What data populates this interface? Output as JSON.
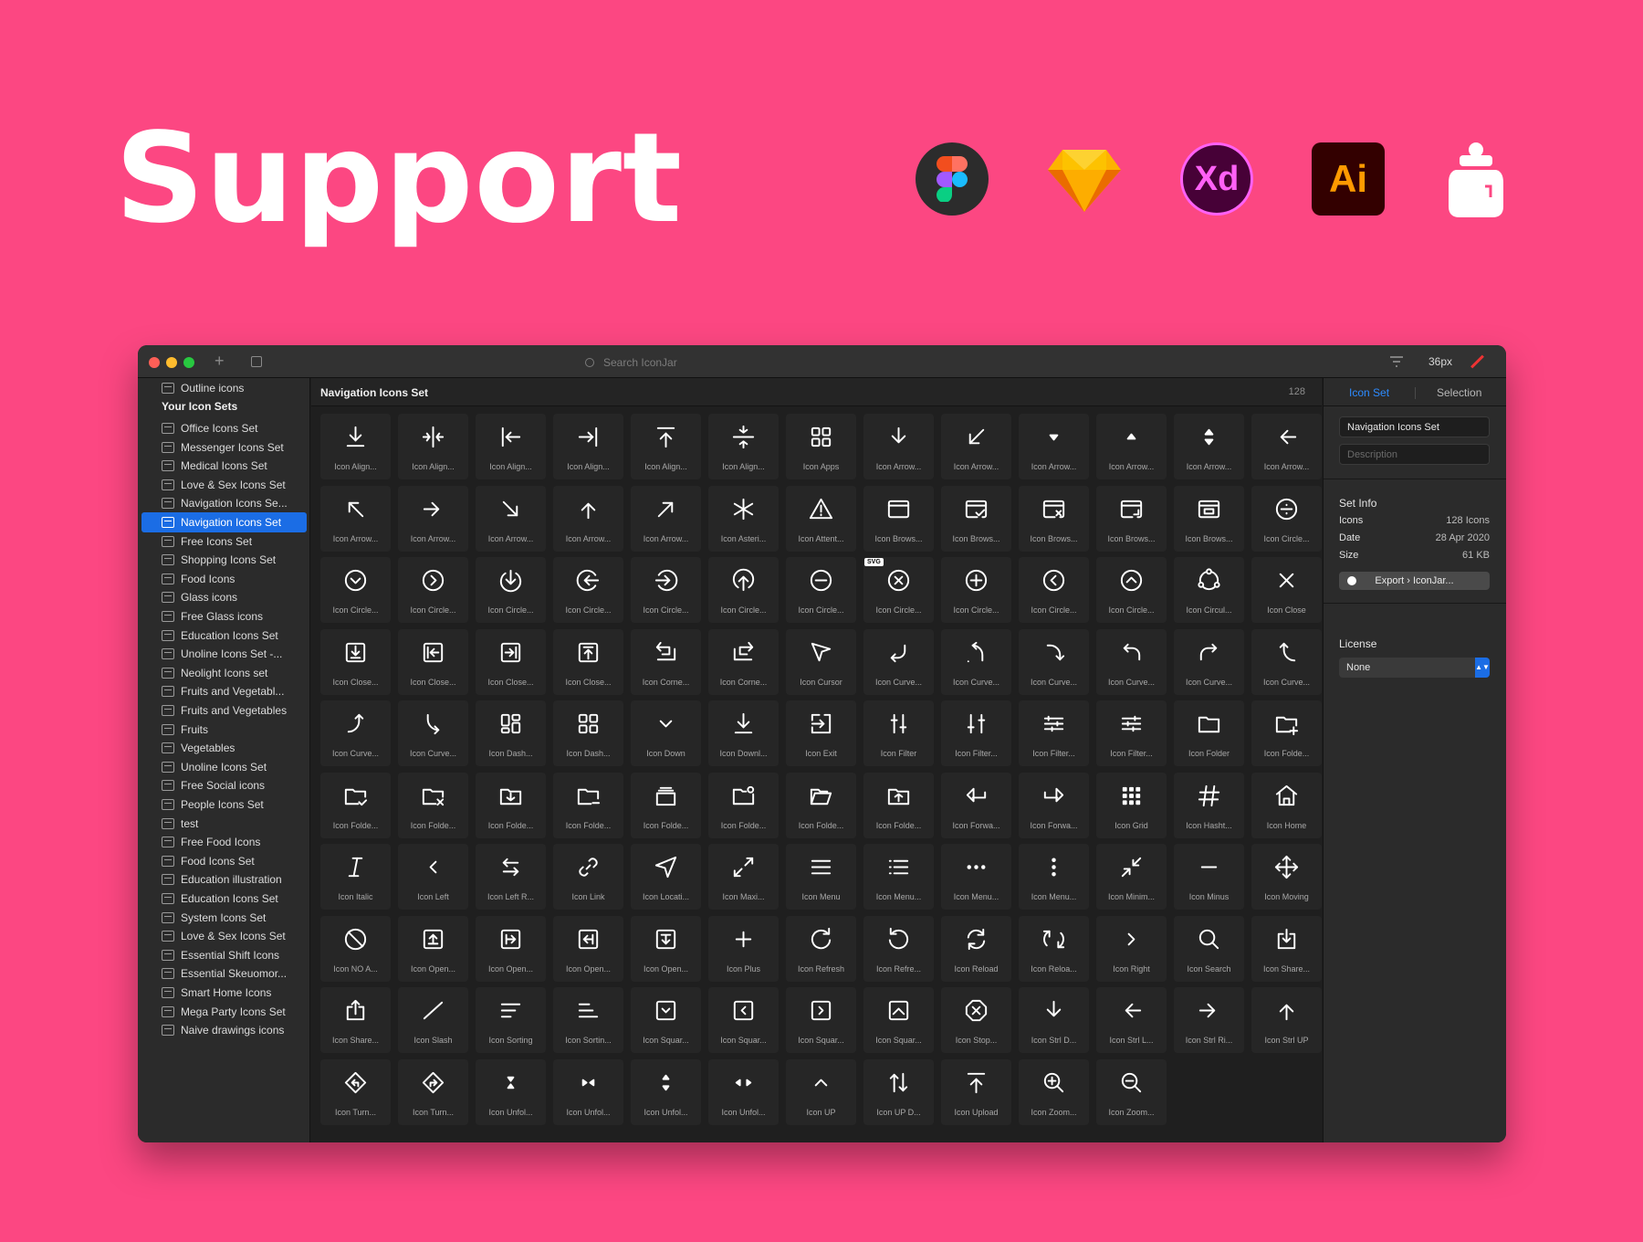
{
  "headline": "Support",
  "logos": [
    {
      "name": "figma-logo"
    },
    {
      "name": "sketch-logo"
    },
    {
      "name": "xd-logo",
      "text": "Xd"
    },
    {
      "name": "illustrator-logo",
      "text": "Ai"
    },
    {
      "name": "iconjar-logo"
    }
  ],
  "colors": {
    "background": "#fc4782",
    "accent": "#1b6de5",
    "tab_active": "#2d8bff"
  },
  "titlebar": {
    "search_placeholder": "Search IconJar",
    "size": "36px"
  },
  "sidebar": {
    "top_item": "Outline icons",
    "heading": "Your Icon Sets",
    "selected_index": 5,
    "items": [
      "Office Icons Set",
      "Messenger Icons Set",
      "Medical Icons Set",
      "Love & Sex Icons Set",
      "Navigation Icons Se...",
      "Navigation Icons Set",
      "Free Icons Set",
      "Shopping Icons Set",
      "Food Icons",
      "Glass icons",
      "Free Glass icons",
      "Education Icons Set",
      "Unoline Icons Set -...",
      "Neolight Icons set",
      "Fruits and Vegetabl...",
      "Fruits and Vegetables",
      "Fruits",
      "Vegetables",
      "Unoline Icons Set",
      "Free Social icons",
      "People Icons Set",
      "test",
      "Free Food Icons",
      "Food Icons Set",
      "Education illustration",
      "Education Icons Set",
      "System Icons Set",
      "Love & Sex Icons Set",
      "Essential Shift Icons",
      "Essential Skeuomor...",
      "Smart Home Icons",
      "Mega Party Icons Set",
      "Naive drawings icons"
    ]
  },
  "main": {
    "title": "Navigation Icons Set",
    "count": "128",
    "icons": [
      {
        "label": "Icon Align...",
        "icon": "align-bottom-icon"
      },
      {
        "label": "Icon Align...",
        "icon": "align-center-h-icon"
      },
      {
        "label": "Icon Align...",
        "icon": "align-left-icon"
      },
      {
        "label": "Icon Align...",
        "icon": "align-right-icon"
      },
      {
        "label": "Icon Align...",
        "icon": "align-top-icon"
      },
      {
        "label": "Icon Align...",
        "icon": "align-center-v-icon"
      },
      {
        "label": "Icon Apps",
        "icon": "apps-icon"
      },
      {
        "label": "Icon Arrow...",
        "icon": "arrow-down-icon"
      },
      {
        "label": "Icon Arrow...",
        "icon": "arrow-down-left-icon"
      },
      {
        "label": "Icon Arrow...",
        "icon": "caret-down-icon"
      },
      {
        "label": "Icon Arrow...",
        "icon": "caret-up-icon"
      },
      {
        "label": "Icon Arrow...",
        "icon": "caret-up-down-icon"
      },
      {
        "label": "Icon Arrow...",
        "icon": "arrow-left-icon"
      },
      {
        "label": "Icon Arrow...",
        "icon": "arrow-up-left-icon"
      },
      {
        "label": "Icon Arrow...",
        "icon": "arrow-right-icon"
      },
      {
        "label": "Icon Arrow...",
        "icon": "arrow-down-right-icon"
      },
      {
        "label": "Icon Arrow...",
        "icon": "arrow-up-icon"
      },
      {
        "label": "Icon Arrow...",
        "icon": "arrow-up-right-icon"
      },
      {
        "label": "Icon Asteri...",
        "icon": "asterisk-icon"
      },
      {
        "label": "Icon Attent...",
        "icon": "attention-icon"
      },
      {
        "label": "Icon Brows...",
        "icon": "browser-icon"
      },
      {
        "label": "Icon Brows...",
        "icon": "browser-check-icon"
      },
      {
        "label": "Icon Brows...",
        "icon": "browser-close-icon"
      },
      {
        "label": "Icon Brows...",
        "icon": "browser-expand-icon"
      },
      {
        "label": "Icon Brows...",
        "icon": "browser-layout-icon"
      },
      {
        "label": "Icon Circle...",
        "icon": "circle-divide-icon"
      },
      {
        "label": "Icon Circle...",
        "icon": "circle-chevron-down-icon"
      },
      {
        "label": "Icon Circle...",
        "icon": "circle-chevron-right-icon"
      },
      {
        "label": "Icon Circle...",
        "icon": "circle-arrow-down-icon"
      },
      {
        "label": "Icon Circle...",
        "icon": "circle-arrow-left-icon"
      },
      {
        "label": "Icon Circle...",
        "icon": "circle-arrow-right-icon"
      },
      {
        "label": "Icon Circle...",
        "icon": "circle-arrow-up-icon"
      },
      {
        "label": "Icon Circle...",
        "icon": "circle-minus-icon"
      },
      {
        "label": "Icon Circle...",
        "icon": "circle-close-icon",
        "badge": "SVG"
      },
      {
        "label": "Icon Circle...",
        "icon": "circle-plus-icon"
      },
      {
        "label": "Icon Circle...",
        "icon": "circle-chevron-left-icon"
      },
      {
        "label": "Icon Circle...",
        "icon": "circle-chevron-up-icon"
      },
      {
        "label": "Icon Circul...",
        "icon": "circular-icon"
      },
      {
        "label": "Icon Close",
        "icon": "close-icon"
      },
      {
        "label": "Icon Close...",
        "icon": "close-down-icon"
      },
      {
        "label": "Icon Close...",
        "icon": "close-left-icon"
      },
      {
        "label": "Icon Close...",
        "icon": "close-right-icon"
      },
      {
        "label": "Icon Close...",
        "icon": "close-up-icon"
      },
      {
        "label": "Icon Corne...",
        "icon": "corner-left-icon"
      },
      {
        "label": "Icon Corne...",
        "icon": "corner-right-icon"
      },
      {
        "label": "Icon Cursor",
        "icon": "cursor-icon"
      },
      {
        "label": "Icon Curve...",
        "icon": "curve-down-left-icon"
      },
      {
        "label": "Icon Curve...",
        "icon": "curve-up-left-icon"
      },
      {
        "label": "Icon Curve...",
        "icon": "curve-down-right-icon"
      },
      {
        "label": "Icon Curve...",
        "icon": "curve-back-icon"
      },
      {
        "label": "Icon Curve...",
        "icon": "curve-forward-icon"
      },
      {
        "label": "Icon Curve...",
        "icon": "curve-up-icon"
      },
      {
        "label": "Icon Curve...",
        "icon": "curve-up-right-icon"
      },
      {
        "label": "Icon Curve...",
        "icon": "curve-down-icon"
      },
      {
        "label": "Icon Dash...",
        "icon": "dashboard-icon"
      },
      {
        "label": "Icon Dash...",
        "icon": "dashboard-grid-icon"
      },
      {
        "label": "Icon Down",
        "icon": "chevron-down-icon"
      },
      {
        "label": "Icon Downl...",
        "icon": "download-icon"
      },
      {
        "label": "Icon Exit",
        "icon": "exit-icon"
      },
      {
        "label": "Icon Filter",
        "icon": "filter-icon"
      },
      {
        "label": "Icon Filter...",
        "icon": "filter-vertical-icon"
      },
      {
        "label": "Icon Filter...",
        "icon": "filter-horizontal-icon"
      },
      {
        "label": "Icon Filter...",
        "icon": "filter-sliders-icon"
      },
      {
        "label": "Icon Folder",
        "icon": "folder-icon"
      },
      {
        "label": "Icon Folde...",
        "icon": "folder-add-icon"
      },
      {
        "label": "Icon Folde...",
        "icon": "folder-check-icon"
      },
      {
        "label": "Icon Folde...",
        "icon": "folder-close-icon"
      },
      {
        "label": "Icon Folde...",
        "icon": "folder-download-icon"
      },
      {
        "label": "Icon Folde...",
        "icon": "folder-minus-icon"
      },
      {
        "label": "Icon Folde...",
        "icon": "folder-stack-icon"
      },
      {
        "label": "Icon Folde...",
        "icon": "folder-dot-icon"
      },
      {
        "label": "Icon Folde...",
        "icon": "folder-open-icon"
      },
      {
        "label": "Icon Folde...",
        "icon": "folder-upload-icon"
      },
      {
        "label": "Icon Forwa...",
        "icon": "forward-left-icon"
      },
      {
        "label": "Icon Forwa...",
        "icon": "forward-right-icon"
      },
      {
        "label": "Icon Grid",
        "icon": "grid-icon"
      },
      {
        "label": "Icon Hasht...",
        "icon": "hashtag-icon"
      },
      {
        "label": "Icon Home",
        "icon": "home-icon"
      },
      {
        "label": "Icon Italic",
        "icon": "italic-icon"
      },
      {
        "label": "Icon Left",
        "icon": "chevron-left-icon"
      },
      {
        "label": "Icon Left R...",
        "icon": "left-right-icon"
      },
      {
        "label": "Icon Link",
        "icon": "link-icon"
      },
      {
        "label": "Icon Locati...",
        "icon": "location-icon"
      },
      {
        "label": "Icon Maxi...",
        "icon": "maximize-icon"
      },
      {
        "label": "Icon Menu",
        "icon": "menu-icon"
      },
      {
        "label": "Icon Menu...",
        "icon": "menu-list-icon"
      },
      {
        "label": "Icon Menu...",
        "icon": "menu-dots-h-icon"
      },
      {
        "label": "Icon Menu...",
        "icon": "menu-dots-v-icon"
      },
      {
        "label": "Icon Minim...",
        "icon": "minimize-icon"
      },
      {
        "label": "Icon Minus",
        "icon": "minus-icon"
      },
      {
        "label": "Icon Moving",
        "icon": "moving-icon"
      },
      {
        "label": "Icon NO A...",
        "icon": "no-access-icon"
      },
      {
        "label": "Icon Open...",
        "icon": "open-up-icon"
      },
      {
        "label": "Icon Open...",
        "icon": "open-right-icon"
      },
      {
        "label": "Icon Open...",
        "icon": "open-left-icon"
      },
      {
        "label": "Icon Open...",
        "icon": "open-down-icon"
      },
      {
        "label": "Icon Plus",
        "icon": "plus-icon"
      },
      {
        "label": "Icon Refresh",
        "icon": "refresh-icon"
      },
      {
        "label": "Icon Refre...",
        "icon": "refresh-back-icon"
      },
      {
        "label": "Icon Reload",
        "icon": "reload-icon"
      },
      {
        "label": "Icon Reloa...",
        "icon": "reload-alt-icon"
      },
      {
        "label": "Icon Right",
        "icon": "chevron-right-icon"
      },
      {
        "label": "Icon Search",
        "icon": "search-icon"
      },
      {
        "label": "Icon Share...",
        "icon": "share-down-icon"
      },
      {
        "label": "Icon Share...",
        "icon": "share-up-icon"
      },
      {
        "label": "Icon Slash",
        "icon": "slash-icon"
      },
      {
        "label": "Icon Sorting",
        "icon": "sorting-icon"
      },
      {
        "label": "Icon Sortin...",
        "icon": "sorting-right-icon"
      },
      {
        "label": "Icon Squar...",
        "icon": "square-chevron-down-icon"
      },
      {
        "label": "Icon Squar...",
        "icon": "square-chevron-left-icon"
      },
      {
        "label": "Icon Squar...",
        "icon": "square-chevron-right-icon"
      },
      {
        "label": "Icon Squar...",
        "icon": "square-chevron-up-icon"
      },
      {
        "label": "Icon Stop...",
        "icon": "stop-icon"
      },
      {
        "label": "Icon Strl D...",
        "icon": "strl-down-icon"
      },
      {
        "label": "Icon Strl L...",
        "icon": "strl-left-icon"
      },
      {
        "label": "Icon Strl Ri...",
        "icon": "strl-right-icon"
      },
      {
        "label": "Icon Strl UP",
        "icon": "strl-up-icon"
      },
      {
        "label": "Icon Turn...",
        "icon": "turn-left-icon"
      },
      {
        "label": "Icon Turn...",
        "icon": "turn-right-icon"
      },
      {
        "label": "Icon Unfol...",
        "icon": "unfold-v-in-icon"
      },
      {
        "label": "Icon Unfol...",
        "icon": "unfold-h-in-icon"
      },
      {
        "label": "Icon Unfol...",
        "icon": "unfold-v-out-icon"
      },
      {
        "label": "Icon Unfol...",
        "icon": "unfold-h-out-icon"
      },
      {
        "label": "Icon UP",
        "icon": "chevron-up-icon"
      },
      {
        "label": "Icon UP D...",
        "icon": "up-down-icon"
      },
      {
        "label": "Icon Upload",
        "icon": "upload-icon"
      },
      {
        "label": "Icon Zoom...",
        "icon": "zoom-in-icon"
      },
      {
        "label": "Icon Zoom...",
        "icon": "zoom-out-icon"
      }
    ]
  },
  "right_panel": {
    "tabs": [
      "Icon Set",
      "Selection"
    ],
    "name_value": "Navigation Icons Set",
    "description_placeholder": "Description",
    "set_info_heading": "Set Info",
    "info": [
      {
        "key": "Icons",
        "value": "128 Icons"
      },
      {
        "key": "Date",
        "value": "28 Apr 2020"
      },
      {
        "key": "Size",
        "value": "61 KB"
      }
    ],
    "export_label": "Export › IconJar...",
    "license_heading": "License",
    "license_value": "None"
  }
}
